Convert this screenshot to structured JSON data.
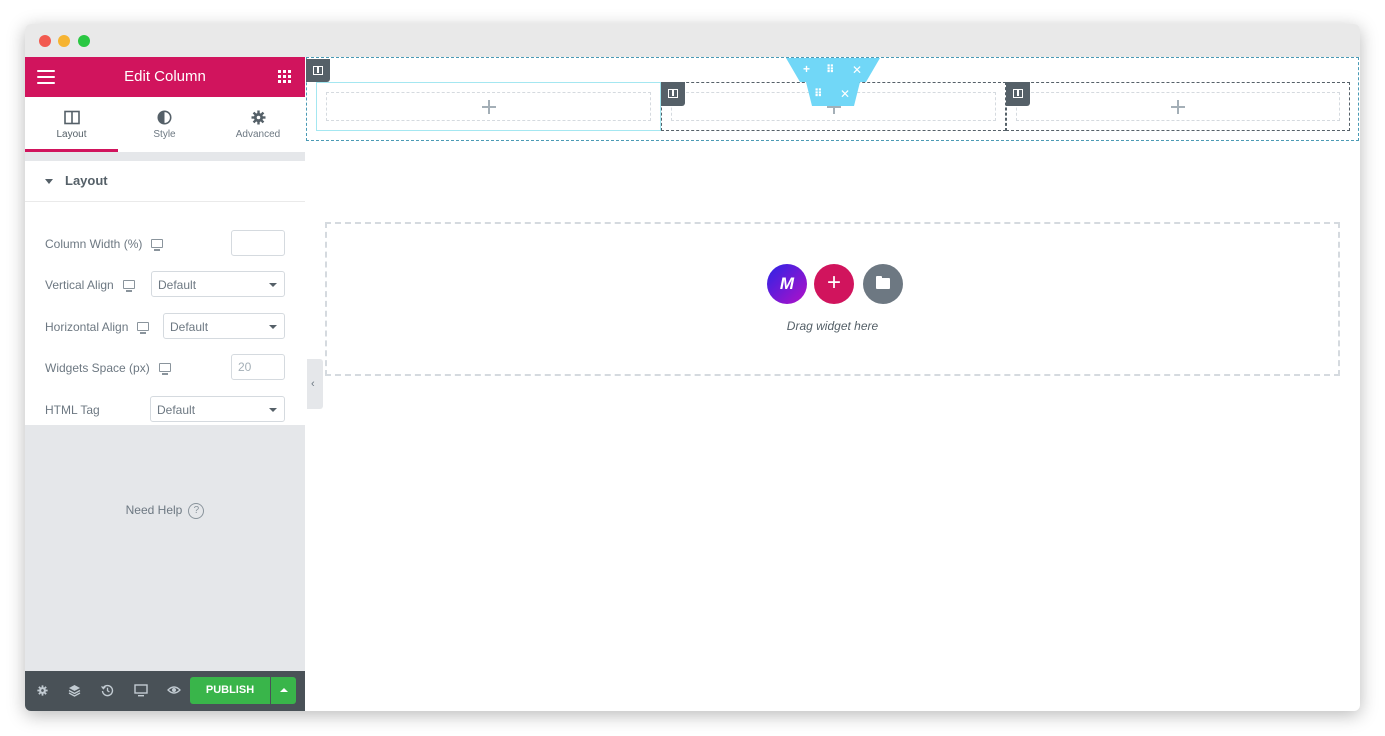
{
  "panel": {
    "title": "Edit Column",
    "tabs": [
      {
        "label": "Layout",
        "icon": "columns-icon",
        "active": true
      },
      {
        "label": "Style",
        "icon": "half-circle-icon",
        "active": false
      },
      {
        "label": "Advanced",
        "icon": "gear-icon",
        "active": false
      }
    ],
    "section_title": "Layout",
    "controls": {
      "column_width": {
        "label": "Column Width (%)",
        "value": ""
      },
      "vertical_align": {
        "label": "Vertical Align",
        "value": "Default"
      },
      "horizontal_align": {
        "label": "Horizontal Align",
        "value": "Default"
      },
      "widgets_space": {
        "label": "Widgets Space (px)",
        "placeholder": "20"
      },
      "html_tag": {
        "label": "HTML Tag",
        "value": "Default"
      }
    },
    "help_text": "Need Help",
    "help_icon_glyph": "?",
    "footer": {
      "icons": [
        "gear-icon",
        "layers-icon",
        "history-icon",
        "responsive-icon",
        "eye-icon"
      ],
      "publish_label": "PUBLISH"
    }
  },
  "canvas": {
    "drop_hint": "Drag widget here",
    "logo_letter": "M",
    "add_glyph": "+",
    "toolbar_glyphs": {
      "add": "+",
      "move": "⠿",
      "close": "✕"
    }
  },
  "colors": {
    "accent": "#d1145d",
    "publish": "#39b54a",
    "toolbar": "#71d7f7",
    "dark": "#556068"
  }
}
